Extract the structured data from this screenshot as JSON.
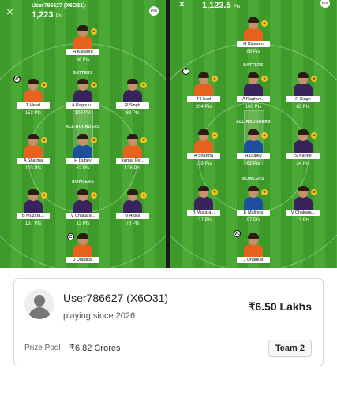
{
  "left_team": {
    "username": "User786627 (X6O31)",
    "team_tag": "T2",
    "total_points": "1,223",
    "pts_unit": "Pts",
    "sections": {
      "batters": "BATTERS",
      "allrounders": "ALL-ROUNDERS",
      "bowlers": "BOWLERS"
    },
    "players": {
      "wk": {
        "name": "H Klaasen",
        "points": "88 Pts"
      },
      "bat1": {
        "name": "T Head",
        "points": "153 Pts"
      },
      "bat2": {
        "name": "A Raghuv...",
        "points": "106 Pts"
      },
      "bat3": {
        "name": "R Singh",
        "points": "83 Pts"
      },
      "ar1": {
        "name": "A Sharma",
        "points": "103 Pts"
      },
      "ar2": {
        "name": "H Dubey",
        "points": "62 Pts"
      },
      "ar3": {
        "name": "Kumar Re...",
        "points": "138 Pts"
      },
      "bowl1": {
        "name": "B Muzara...",
        "points": "137 Pts"
      },
      "bowl2": {
        "name": "V Chakara...",
        "points": "13 Pts"
      },
      "bowl3": {
        "name": "V Arora",
        "points": "78 Pts"
      },
      "bowl4": {
        "name": "J Unadkat",
        "points": ""
      }
    }
  },
  "right_team": {
    "total_points": "1,123.5",
    "pts_unit": "Pts",
    "sections": {
      "batters": "BATTERS",
      "allrounders": "ALL-ROUNDERS",
      "bowlers": "BOWLERS"
    },
    "players": {
      "wk": {
        "name": "H Klaasen",
        "points": "88 Pts"
      },
      "bat1": {
        "name": "T Head",
        "points": "204 Pts"
      },
      "bat2": {
        "name": "A Raghuv...",
        "points": "106 Pts"
      },
      "bat3": {
        "name": "R Singh",
        "points": "83 Pts"
      },
      "ar1": {
        "name": "A Sharma",
        "points": "103 Pts"
      },
      "ar2": {
        "name": "H Dubey",
        "points": "62 Pts"
      },
      "ar3": {
        "name": "S Narine",
        "points": "34 Pts"
      },
      "bowl1": {
        "name": "B Muzara...",
        "points": "137 Pts"
      },
      "bowl2": {
        "name": "E Malinga",
        "points": "97 Pts"
      },
      "bowl3": {
        "name": "V Chakara...",
        "points": "13 Pts"
      },
      "bowl4": {
        "name": "J Unadkat",
        "points": ""
      }
    }
  },
  "badges": {
    "captain": "C",
    "vice_captain": "VC",
    "star": "★"
  },
  "header": {
    "close_icon": "×",
    "logo_text": "PTS"
  },
  "card": {
    "username": "User786627 (X6O31)",
    "playing_since": "playing since 2026",
    "amount": "₹6.50 Lakhs",
    "prize_pool_label": "Prize Pool",
    "prize_pool_value": "₹6.82 Crores",
    "team_label": "Team 2"
  },
  "colors": {
    "pitch_light": "#4aa834",
    "pitch_dark": "#3f9a2c",
    "jersey_srh": "#e8621f",
    "jersey_kkr": "#3a225d",
    "jersey_lsg": "#1e4e9e"
  }
}
